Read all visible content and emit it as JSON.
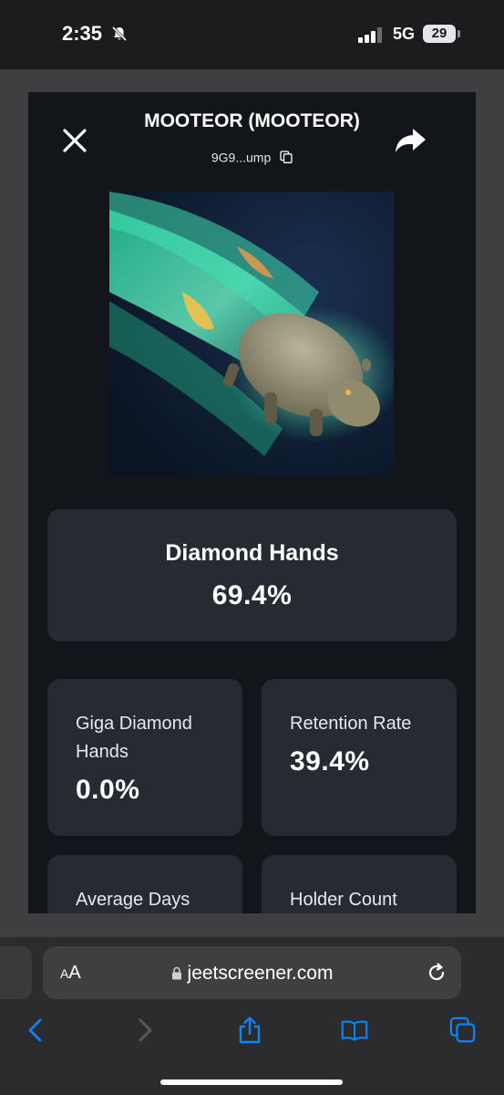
{
  "status_bar": {
    "time": "2:35",
    "network": "5G",
    "battery": "29",
    "icons": [
      "bell-slash-icon",
      "cellular-signal-icon",
      "battery-icon"
    ]
  },
  "modal": {
    "title": "MOOTEOR (MOOTEOR)",
    "address": "9G9...ump",
    "icons": [
      "close-icon",
      "share-arrow-icon",
      "copy-icon"
    ],
    "token_image": "flying-hippo-comet-image",
    "stats": {
      "diamond_hands": {
        "label": "Diamond Hands",
        "value": "69.4%"
      },
      "giga_diamond_hands": {
        "label": "Giga Diamond Hands",
        "value": "0.0%"
      },
      "retention_rate": {
        "label": "Retention Rate",
        "value": "39.4%"
      },
      "average_days": {
        "label": "Average Days"
      },
      "holder_count": {
        "label": "Holder Count"
      }
    }
  },
  "browser": {
    "text_size_button": "AA",
    "url": "jeetscreener.com",
    "toolbar_icons": [
      "back-icon",
      "forward-icon",
      "share-icon",
      "bookmarks-icon",
      "tabs-icon"
    ]
  },
  "colors": {
    "modal_background": "#121519",
    "card_background": "#262b33",
    "page_background": "#3f3f41",
    "accent_blue": "#0a84ff"
  }
}
